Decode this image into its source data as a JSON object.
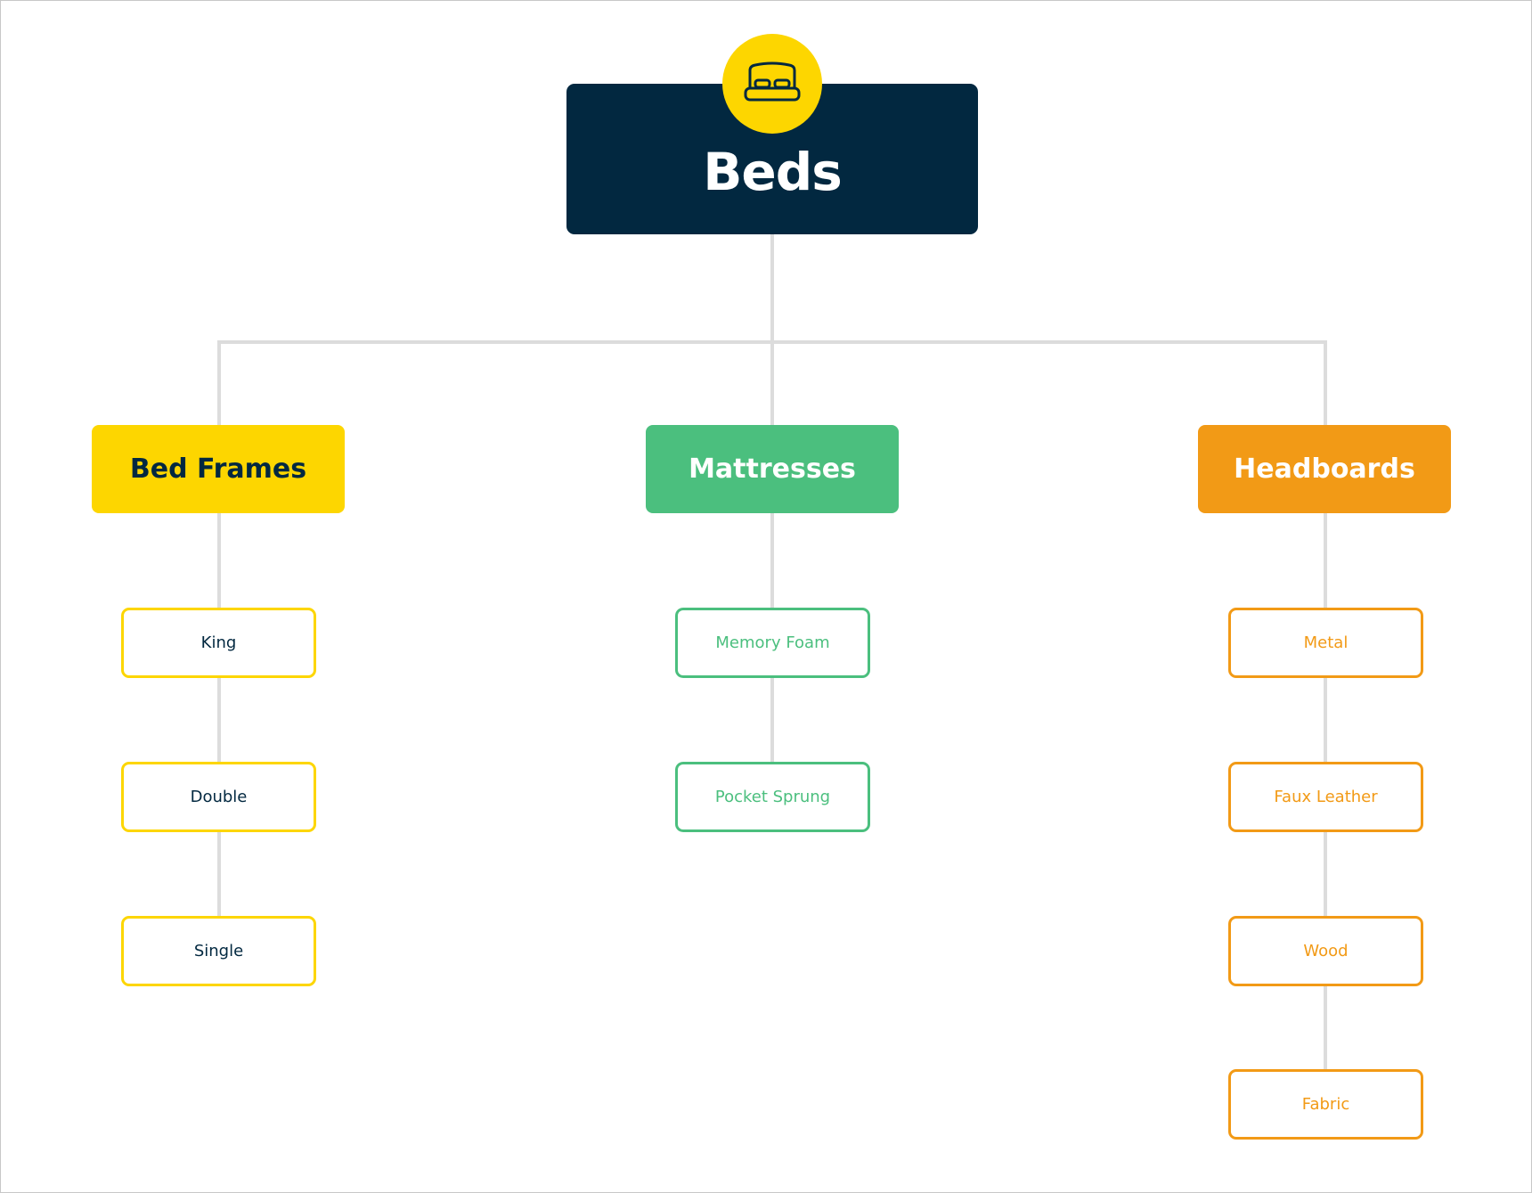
{
  "root": {
    "label": "Beds",
    "icon": "bed-icon"
  },
  "colors": {
    "navy": "#022840",
    "yellow": "#FDD600",
    "green": "#4BBF7E",
    "orange": "#F29A16",
    "connector": "#dcdcdc"
  },
  "categories": [
    {
      "label": "Bed Frames",
      "items": [
        "King",
        "Double",
        "Single"
      ]
    },
    {
      "label": "Mattresses",
      "items": [
        "Memory Foam",
        "Pocket Sprung"
      ]
    },
    {
      "label": "Headboards",
      "items": [
        "Metal",
        "Faux Leather",
        "Wood",
        "Fabric"
      ]
    }
  ]
}
